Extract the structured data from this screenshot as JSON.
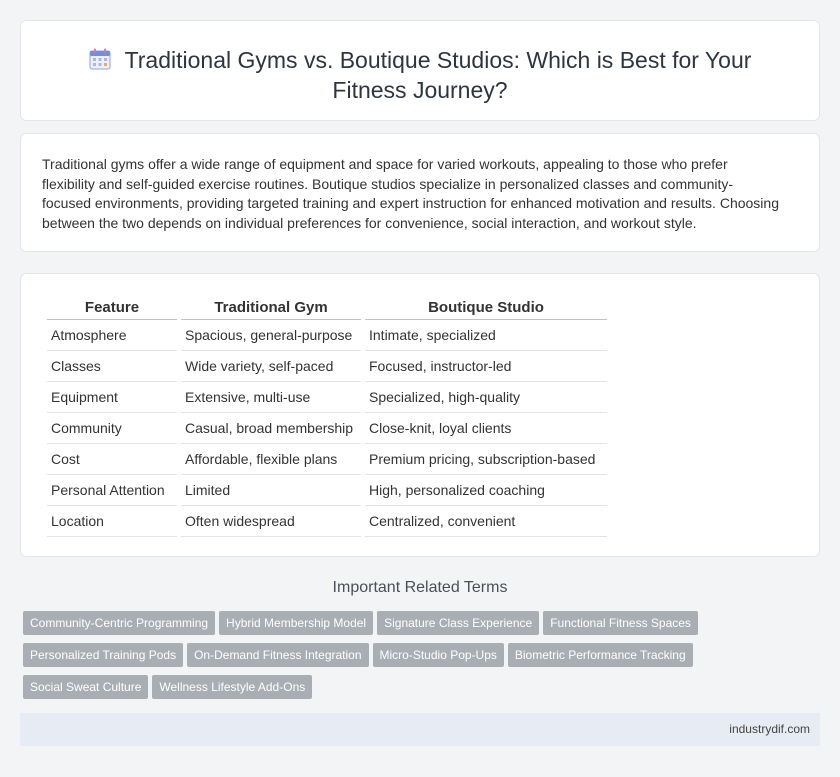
{
  "header": {
    "title": "Traditional Gyms vs. Boutique Studios: Which is Best for Your Fitness Journey?"
  },
  "intro": {
    "text": "Traditional gyms offer a wide range of equipment and space for varied workouts, appealing to those who prefer flexibility and self-guided exercise routines. Boutique studios specialize in personalized classes and community-focused environments, providing targeted training and expert instruction for enhanced motivation and results. Choosing between the two depends on individual preferences for convenience, social interaction, and workout style."
  },
  "table": {
    "headers": [
      "Feature",
      "Traditional Gym",
      "Boutique Studio"
    ],
    "rows": [
      [
        "Atmosphere",
        "Spacious, general-purpose",
        "Intimate, specialized"
      ],
      [
        "Classes",
        "Wide variety, self-paced",
        "Focused, instructor-led"
      ],
      [
        "Equipment",
        "Extensive, multi-use",
        "Specialized, high-quality"
      ],
      [
        "Community",
        "Casual, broad membership",
        "Close-knit, loyal clients"
      ],
      [
        "Cost",
        "Affordable, flexible plans",
        "Premium pricing, subscription-based"
      ],
      [
        "Personal Attention",
        "Limited",
        "High, personalized coaching"
      ],
      [
        "Location",
        "Often widespread",
        "Centralized, convenient"
      ]
    ]
  },
  "related": {
    "title": "Important Related Terms",
    "tags": [
      "Community-Centric Programming",
      "Hybrid Membership Model",
      "Signature Class Experience",
      "Functional Fitness Spaces",
      "Personalized Training Pods",
      "On-Demand Fitness Integration",
      "Micro-Studio Pop-Ups",
      "Biometric Performance Tracking",
      "Social Sweat Culture",
      "Wellness Lifestyle Add-Ons"
    ]
  },
  "footer": {
    "site": "industrydif.com"
  },
  "icons": {
    "title_icon": "calendar-icon"
  }
}
